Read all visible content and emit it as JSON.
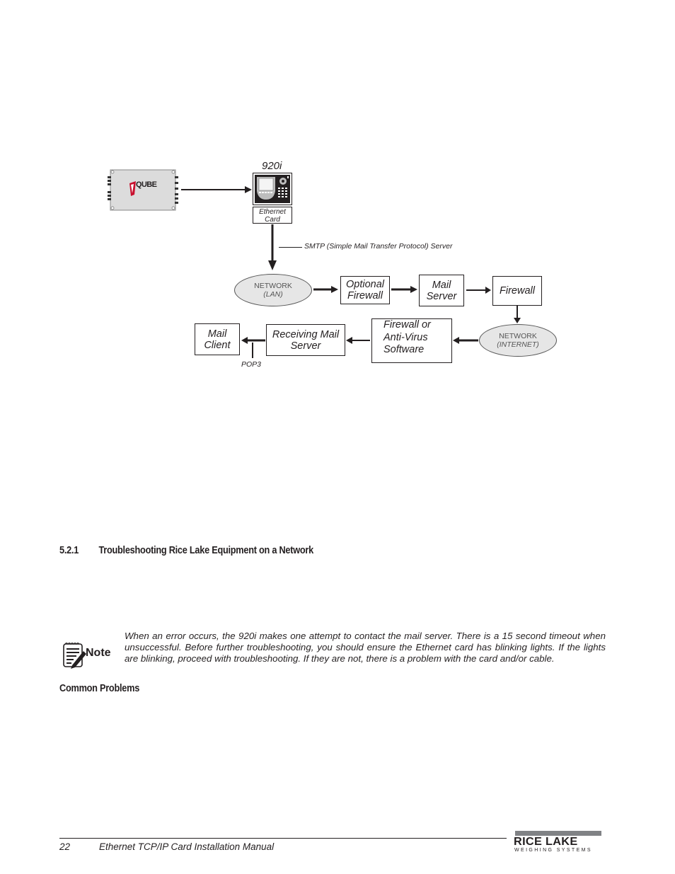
{
  "diagram": {
    "iqube_label": "iQUBE",
    "indicator_label": "920i",
    "ethernet_card_label": [
      "Ethernet",
      "Card"
    ],
    "smtp_label": "SMTP (Simple Mail Transfer Protocol) Server",
    "network_lan": {
      "title": "NETWORK",
      "sub": "(LAN)"
    },
    "optional_firewall": [
      "Optional",
      "Firewall"
    ],
    "mail_server": [
      "Mail",
      "Server"
    ],
    "firewall": "Firewall",
    "network_internet": {
      "title": "NETWORK",
      "sub": "(INTERNET)"
    },
    "firewall_antivirus": [
      "Firewall or",
      "Anti-Virus",
      "Software"
    ],
    "receiving_mail_server": [
      "Receiving Mail",
      "Server"
    ],
    "mail_client": [
      "Mail",
      "Client"
    ],
    "pop3_label": "POP3"
  },
  "section": {
    "number": "5.2.1",
    "title": "Troubleshooting Rice Lake Equipment on a Network"
  },
  "note": {
    "icon_label": "Note",
    "text": "When an error occurs, the 920i makes one attempt to contact the mail server. There is a 15 second timeout when unsuccessful. Before further troubleshooting, you should ensure the Ethernet card has blinking lights. If the lights are blinking, proceed with troubleshooting. If they are not, there is a problem with the card and/or cable."
  },
  "subsection": {
    "title": "Common Problems"
  },
  "footer": {
    "page_number": "22",
    "manual_title": "Ethernet TCP/IP Card Installation Manual",
    "logo_main": "RICE LAKE",
    "logo_sub": "WEIGHING SYSTEMS"
  }
}
